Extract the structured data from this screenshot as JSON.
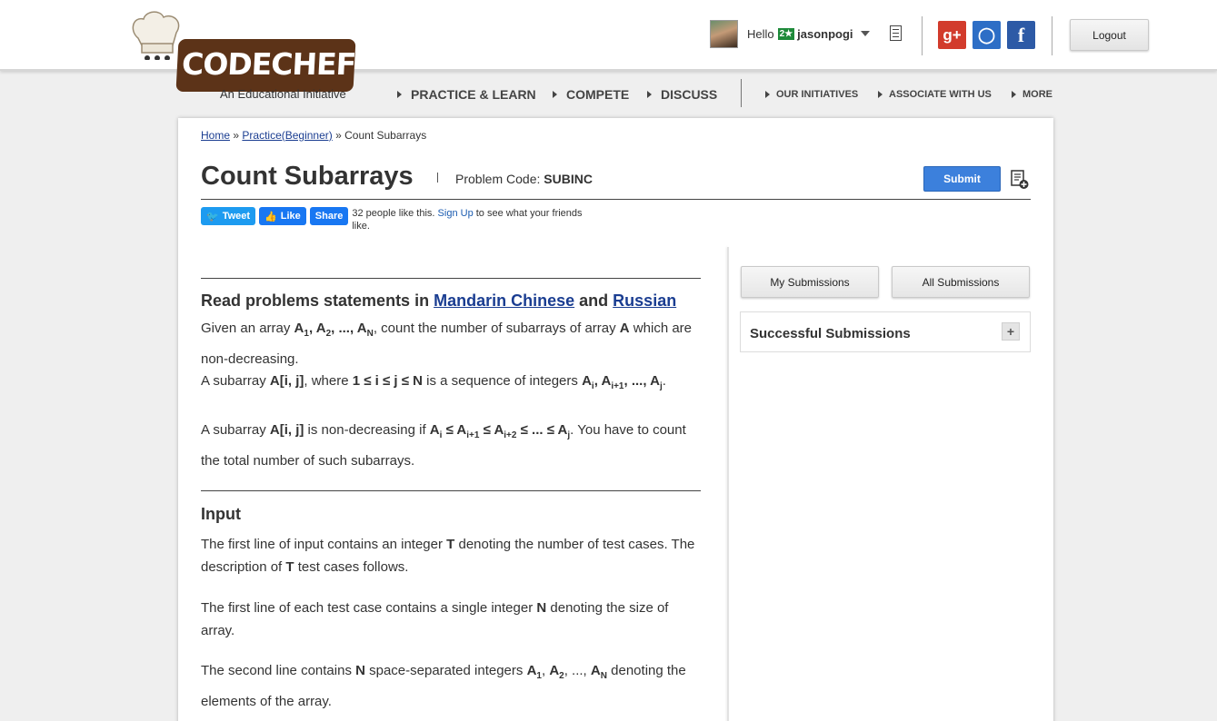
{
  "header": {
    "logo_text": "CODECHEF",
    "tagline": "An Educational Initiative",
    "greeting": "Hello",
    "stars": "2★",
    "username": "jasonpogi",
    "logout_label": "Logout",
    "social": {
      "gplus": "g+",
      "github": "◯",
      "facebook": "f"
    }
  },
  "nav": {
    "main": [
      "PRACTICE & LEARN",
      "COMPETE",
      "DISCUSS"
    ],
    "secondary": [
      "OUR INITIATIVES",
      "ASSOCIATE WITH US",
      "MORE"
    ]
  },
  "breadcrumb": {
    "home": "Home",
    "sep1": "»",
    "practice": "Practice(Beginner)",
    "sep2": "»",
    "current": "Count Subarrays"
  },
  "problem": {
    "title": "Count Subarrays",
    "code_label": "Problem Code:",
    "code": "SUBINC",
    "submit_label": "Submit"
  },
  "social_row": {
    "tweet": "Tweet",
    "like": "Like",
    "share": "Share",
    "like_text_pre": "32 people like this.",
    "signup": "Sign Up",
    "like_text_post": "to see what your friends like."
  },
  "statement": {
    "read_prefix": "Read problems statements in",
    "lang1": "Mandarin Chinese",
    "and": "and",
    "lang2": "Russian",
    "input_heading": "Input"
  },
  "sidebar": {
    "my_submissions": "My Submissions",
    "all_submissions": "All Submissions",
    "successful_title": "Successful Submissions",
    "expand_label": "+"
  },
  "colors": {
    "accent": "#3c80dc",
    "link": "#1a3d91",
    "brand": "#5c3318"
  }
}
